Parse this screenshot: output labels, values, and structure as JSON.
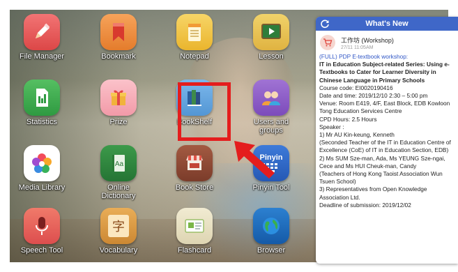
{
  "apps": [
    {
      "label": "File Manager",
      "icon": "pencil-icon",
      "color": "#ee5a5a"
    },
    {
      "label": "Bookmark",
      "icon": "bookmark-icon",
      "color": "#f08a3c"
    },
    {
      "label": "Notepad",
      "icon": "notepad-icon",
      "color": "#f3c84a"
    },
    {
      "label": "Lesson",
      "icon": "video-board-icon",
      "color": "#39a64a"
    },
    {
      "label": "Statistics",
      "icon": "spreadsheet-icon",
      "color": "#3aa94c"
    },
    {
      "label": "Prize",
      "icon": "gift-icon",
      "color": "#f4a3b0"
    },
    {
      "label": "BookShelf",
      "icon": "books-icon",
      "color": "#6aa9e0"
    },
    {
      "label": "Users and groups",
      "icon": "users-icon",
      "color": "#8a58c4"
    },
    {
      "label": "Media Library",
      "icon": "flower-icon",
      "color": "#ffffff"
    },
    {
      "label": "Online Dictionary",
      "icon": "dictionary-icon",
      "color": "#2f8a3d"
    },
    {
      "label": "Book Store",
      "icon": "store-icon",
      "color": "#8e4b36"
    },
    {
      "label": "Pinyin Tool",
      "icon": "keyboard-icon",
      "color": "#2f67c9"
    },
    {
      "label": "Speech Tool",
      "icon": "microphone-icon",
      "color": "#e85f5f"
    },
    {
      "label": "Vocabulary",
      "icon": "character-card-icon",
      "color": "#d99a43"
    },
    {
      "label": "Flashcard",
      "icon": "flashcard-icon",
      "color": "#e9e2c6"
    },
    {
      "label": "Browser",
      "icon": "globe-icon",
      "color": "#1f6fbf"
    }
  ],
  "pinyin_badge": "Pinyin",
  "vocab_char": "字",
  "panel": {
    "title": "What's New",
    "message_title": "工作坊 (Workshop)",
    "message_time": "27/11 11:05AM",
    "lines": [
      {
        "text": "(FULL) PDP E-textbook workshop:",
        "style": "blue"
      },
      {
        "text": "IT in Education Subject-related Series: Using e-Textbooks to Cater for Learner Diversity in Chinese Language in Primary Schools",
        "style": "bold"
      },
      {
        "text": "Course code: EI0020190416",
        "style": ""
      },
      {
        "text": "Date and time: 2019/12/10 2:30 – 5:00 pm",
        "style": ""
      },
      {
        "text": "Venue: Room E419, 4/F, East Block, EDB Kowloon Tong Education Services Centre",
        "style": ""
      },
      {
        "text": "CPD Hours: 2.5 Hours",
        "style": ""
      },
      {
        "text": "Speaker :",
        "style": ""
      },
      {
        "text": "1) Mr AU Kin-keung, Kenneth",
        "style": ""
      },
      {
        "text": "(Seconded Teacher of the IT in Education Centre of Excellence (CoE) of IT in Education Section, EDB)",
        "style": ""
      },
      {
        "text": "2) Ms SUM Sze-man, Ada, Ms YEUNG Sze-ngai, Cece and Ms HUI Cheuk-man, Candy",
        "style": ""
      },
      {
        "text": "(Teachers of Hong Kong Taoist Association Wun Tsuen School)",
        "style": ""
      },
      {
        "text": "3) Representatives from Open Knowledge Association Ltd.",
        "style": ""
      },
      {
        "text": "Deadline of submission: 2019/12/02",
        "style": ""
      }
    ]
  }
}
